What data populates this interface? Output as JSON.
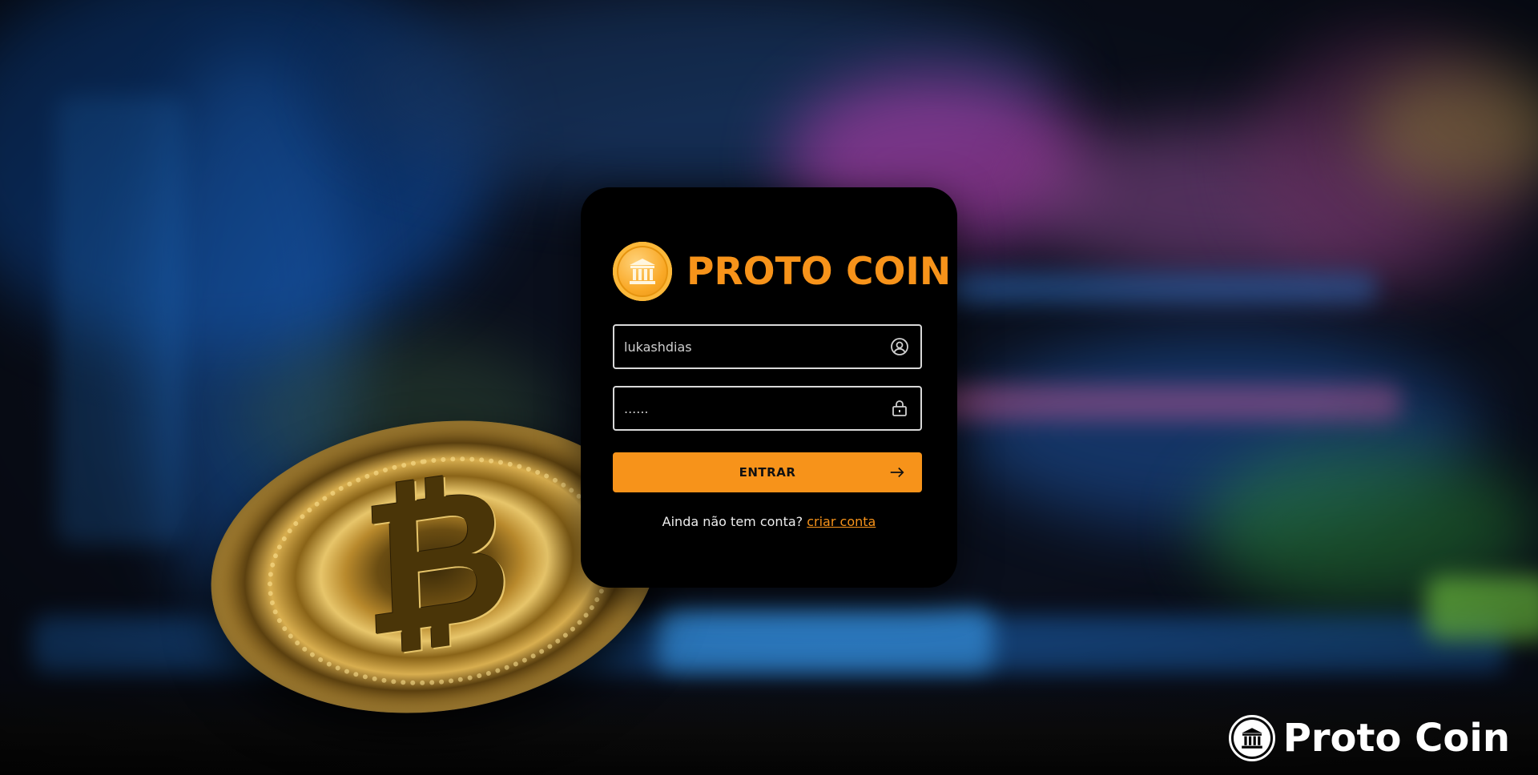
{
  "brand": {
    "title": "PROTO COIN",
    "icon": "bank-icon",
    "color": "#f7931a"
  },
  "login": {
    "username_value": "lukashdias",
    "password_value": "......",
    "username_icon": "user-circle-icon",
    "password_icon": "lock-icon",
    "submit_label": "ENTRAR",
    "submit_icon": "arrow-right-icon",
    "signup_prompt": "Ainda não tem conta?",
    "signup_link": "criar conta"
  },
  "footer": {
    "title": "Proto Coin",
    "icon": "bank-icon"
  },
  "background": {
    "decoration": "bitcoin-coin",
    "symbol": "₿"
  }
}
